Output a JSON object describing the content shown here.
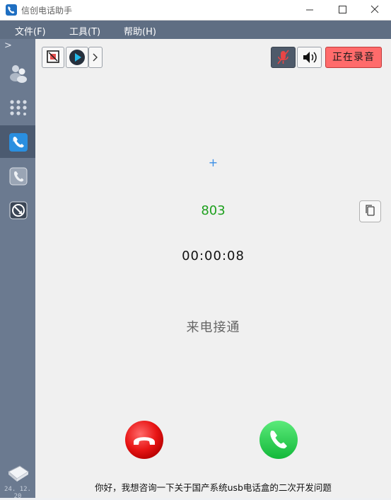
{
  "window": {
    "title": "信创电话助手"
  },
  "menu": {
    "items": [
      "文件(F)",
      "工具(T)",
      "帮助(H)"
    ]
  },
  "sidebar": {
    "items": [
      "contacts-icon",
      "dialpad-icon",
      "active-call-icon",
      "call-log-icon",
      "transfer-icon"
    ],
    "active_index": 2,
    "date_text": "24. 12. 20"
  },
  "toolbar": {
    "recording_label": "正在录音",
    "recording_color": "#ff6b6b",
    "mic_muted": true
  },
  "call": {
    "prefix": "+",
    "number": "803",
    "duration": "00:00:08",
    "status": "来电接通",
    "number_color": "#1ea01e"
  },
  "footer": {
    "message": "你好，我想咨询一下关于国产系统usb电话盒的二次开发问题"
  }
}
